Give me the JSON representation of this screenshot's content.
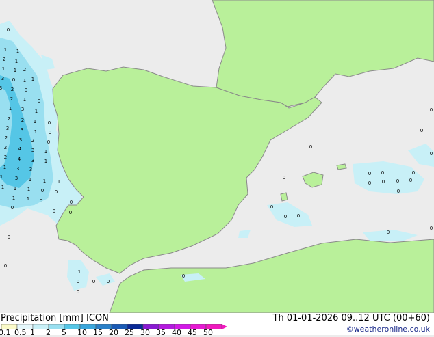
{
  "map": {
    "colors": {
      "sea": "#ececec",
      "land": "#b9f09a",
      "coast": "#8a8a8a",
      "precip_light": "#c8f0f7",
      "precip_mid": "#99dff0",
      "precip_heavy": "#55c6e6"
    },
    "labels": [
      {
        "text": "0",
        "xp": 12,
        "yp": 46
      },
      {
        "text": "1",
        "xp": 8,
        "yp": 75
      },
      {
        "text": "1",
        "xp": 26,
        "yp": 77
      },
      {
        "text": "2",
        "xp": 6,
        "yp": 89
      },
      {
        "text": "1",
        "xp": 24,
        "yp": 92
      },
      {
        "text": "1",
        "xp": 5,
        "yp": 103
      },
      {
        "text": "1",
        "xp": 22,
        "yp": 105
      },
      {
        "text": "2",
        "xp": 36,
        "yp": 104
      },
      {
        "text": "3",
        "xp": 4,
        "yp": 117
      },
      {
        "text": "0",
        "xp": 20,
        "yp": 119
      },
      {
        "text": "1",
        "xp": 36,
        "yp": 120
      },
      {
        "text": "1",
        "xp": 48,
        "yp": 118
      },
      {
        "text": "3",
        "xp": 1,
        "yp": 131
      },
      {
        "text": "2",
        "xp": 18,
        "yp": 133
      },
      {
        "text": "0",
        "xp": 38,
        "yp": 134
      },
      {
        "text": "2",
        "xp": 17,
        "yp": 147
      },
      {
        "text": "1",
        "xp": 36,
        "yp": 148
      },
      {
        "text": "0",
        "xp": 57,
        "yp": 150
      },
      {
        "text": "1",
        "xp": 15,
        "yp": 161
      },
      {
        "text": "3",
        "xp": 33,
        "yp": 162
      },
      {
        "text": "1",
        "xp": 53,
        "yp": 165
      },
      {
        "text": "2",
        "xp": 13,
        "yp": 176
      },
      {
        "text": "2",
        "xp": 33,
        "yp": 178
      },
      {
        "text": "1",
        "xp": 51,
        "yp": 180
      },
      {
        "text": "0",
        "xp": 72,
        "yp": 182
      },
      {
        "text": "3",
        "xp": 11,
        "yp": 190
      },
      {
        "text": "3",
        "xp": 32,
        "yp": 192
      },
      {
        "text": "1",
        "xp": 52,
        "yp": 195
      },
      {
        "text": "0",
        "xp": 73,
        "yp": 196
      },
      {
        "text": "2",
        "xp": 9,
        "yp": 204
      },
      {
        "text": "3",
        "xp": 30,
        "yp": 207
      },
      {
        "text": "2",
        "xp": 48,
        "yp": 208
      },
      {
        "text": "0",
        "xp": 71,
        "yp": 210
      },
      {
        "text": "2",
        "xp": 8,
        "yp": 218
      },
      {
        "text": "4",
        "xp": 29,
        "yp": 220
      },
      {
        "text": "3",
        "xp": 48,
        "yp": 222
      },
      {
        "text": "1",
        "xp": 67,
        "yp": 224
      },
      {
        "text": "2",
        "xp": 8,
        "yp": 232
      },
      {
        "text": "4",
        "xp": 28,
        "yp": 235
      },
      {
        "text": "3",
        "xp": 48,
        "yp": 237
      },
      {
        "text": "1",
        "xp": 67,
        "yp": 238
      },
      {
        "text": "1",
        "xp": 7,
        "yp": 247
      },
      {
        "text": "3",
        "xp": 26,
        "yp": 249
      },
      {
        "text": "3",
        "xp": 45,
        "yp": 250
      },
      {
        "text": "1",
        "xp": 2,
        "yp": 261
      },
      {
        "text": "3",
        "xp": 24,
        "yp": 263
      },
      {
        "text": "1",
        "xp": 44,
        "yp": 265
      },
      {
        "text": "1",
        "xp": 65,
        "yp": 267
      },
      {
        "text": "1",
        "xp": 86,
        "yp": 268
      },
      {
        "text": "1",
        "xp": 4,
        "yp": 276
      },
      {
        "text": "1",
        "xp": 22,
        "yp": 278
      },
      {
        "text": "1",
        "xp": 42,
        "yp": 279
      },
      {
        "text": "0",
        "xp": 62,
        "yp": 281
      },
      {
        "text": "0",
        "xp": 82,
        "yp": 283
      },
      {
        "text": "1",
        "xp": 20,
        "yp": 292
      },
      {
        "text": "1",
        "xp": 41,
        "yp": 293
      },
      {
        "text": "0",
        "xp": 60,
        "yp": 296
      },
      {
        "text": "0",
        "xp": 104,
        "yp": 298
      },
      {
        "text": "0",
        "xp": 18,
        "yp": 306
      },
      {
        "text": "0",
        "xp": 79,
        "yp": 311
      },
      {
        "text": "0",
        "xp": 103,
        "yp": 313
      },
      {
        "text": "0",
        "xp": 13,
        "yp": 349
      },
      {
        "text": "0",
        "xp": 8,
        "yp": 391
      },
      {
        "text": "0",
        "xp": 454,
        "yp": 217
      },
      {
        "text": "0",
        "xp": 415,
        "yp": 262
      },
      {
        "text": "0",
        "xp": 540,
        "yp": 256
      },
      {
        "text": "0",
        "xp": 559,
        "yp": 255
      },
      {
        "text": "0",
        "xp": 604,
        "yp": 255
      },
      {
        "text": "0",
        "xp": 540,
        "yp": 270
      },
      {
        "text": "0",
        "xp": 560,
        "yp": 268
      },
      {
        "text": "0",
        "xp": 581,
        "yp": 267
      },
      {
        "text": "0",
        "xp": 600,
        "yp": 266
      },
      {
        "text": "0",
        "xp": 582,
        "yp": 282
      },
      {
        "text": "0",
        "xp": 616,
        "yp": 193
      },
      {
        "text": "0",
        "xp": 630,
        "yp": 163
      },
      {
        "text": "0",
        "xp": 397,
        "yp": 305
      },
      {
        "text": "0",
        "xp": 417,
        "yp": 319
      },
      {
        "text": "0",
        "xp": 436,
        "yp": 318
      },
      {
        "text": "0",
        "xp": 567,
        "yp": 342
      },
      {
        "text": "0",
        "xp": 630,
        "yp": 336
      },
      {
        "text": "0",
        "xp": 630,
        "yp": 227
      },
      {
        "text": "0",
        "xp": 268,
        "yp": 406
      },
      {
        "text": "0",
        "xp": 114,
        "yp": 414
      },
      {
        "text": "0",
        "xp": 137,
        "yp": 414
      },
      {
        "text": "0",
        "xp": 158,
        "yp": 414
      },
      {
        "text": "0",
        "xp": 114,
        "yp": 429
      },
      {
        "text": "1",
        "xp": 116,
        "yp": 400
      }
    ]
  },
  "footer": {
    "title": "Precipitation [mm]  ICON",
    "datetime": "Th 01-01-2026 09..12 UTC (00+60)",
    "credit": "©weatheronline.co.uk",
    "scale_labels": [
      "0.1",
      "0.5",
      "1",
      "2",
      "5",
      "10",
      "15",
      "20",
      "25",
      "30",
      "35",
      "40",
      "45",
      "50"
    ],
    "scale_colors": [
      "#fafac8",
      "#e6f8fc",
      "#c8f0f7",
      "#99dff0",
      "#55c6e6",
      "#3aa6dc",
      "#2a80c8",
      "#1a5ab4",
      "#0a2a96",
      "#8a1ad2",
      "#b41ade",
      "#d21ae6",
      "#e61ad2",
      "#f01abe"
    ]
  }
}
